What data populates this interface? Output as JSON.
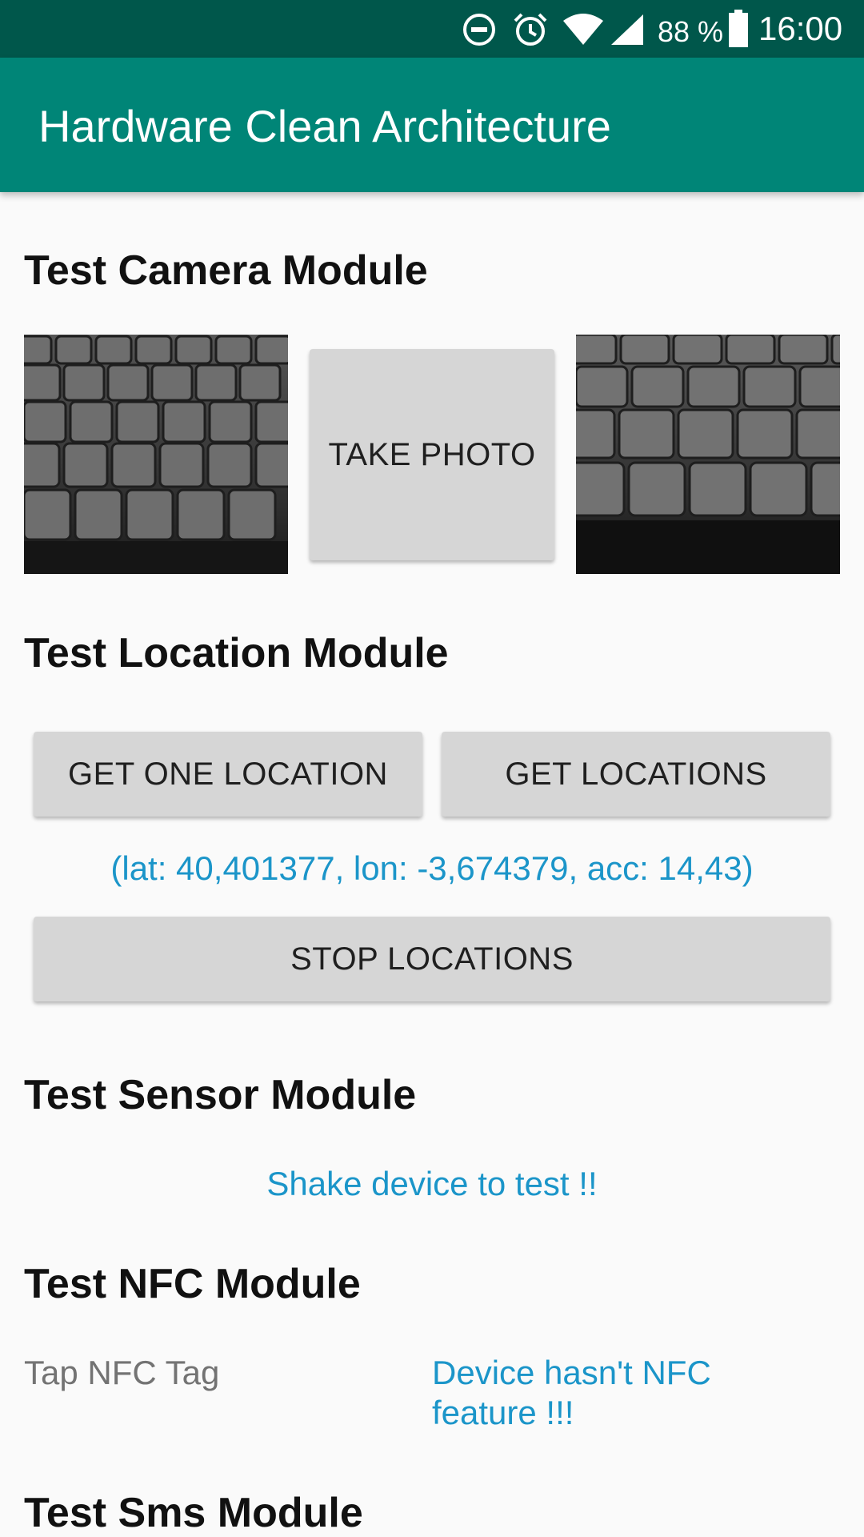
{
  "status_bar": {
    "battery_percent": "88 %",
    "time": "16:00",
    "icons": [
      "do-not-disturb-icon",
      "alarm-icon",
      "wifi-icon",
      "signal-icon",
      "battery-icon"
    ],
    "background_color": "#00574b"
  },
  "app_bar": {
    "title": "Hardware Clean Architecture",
    "background_color": "#008577"
  },
  "camera_module": {
    "title": "Test Camera Module",
    "take_photo_label": "TAKE PHOTO",
    "photos": [
      "keyboard-photo-left",
      "keyboard-photo-right"
    ]
  },
  "location_module": {
    "title": "Test Location Module",
    "get_one_location_label": "GET ONE LOCATION",
    "get_locations_label": "GET LOCATIONS",
    "location_result": "(lat: 40,401377, lon: -3,674379, acc: 14,43)",
    "stop_locations_label": "STOP LOCATIONS"
  },
  "sensor_module": {
    "title": "Test Sensor Module",
    "message": "Shake device to test !!"
  },
  "nfc_module": {
    "title": "Test NFC Module",
    "tap_label": "Tap NFC Tag",
    "status_line1": "Device hasn't NFC",
    "status_line2": "feature !!!"
  },
  "sms_module": {
    "title": "Test Sms Module"
  },
  "colors": {
    "accent_text": "#1b95c9",
    "button_bg": "#d6d6d6",
    "page_bg": "#fafafa"
  }
}
